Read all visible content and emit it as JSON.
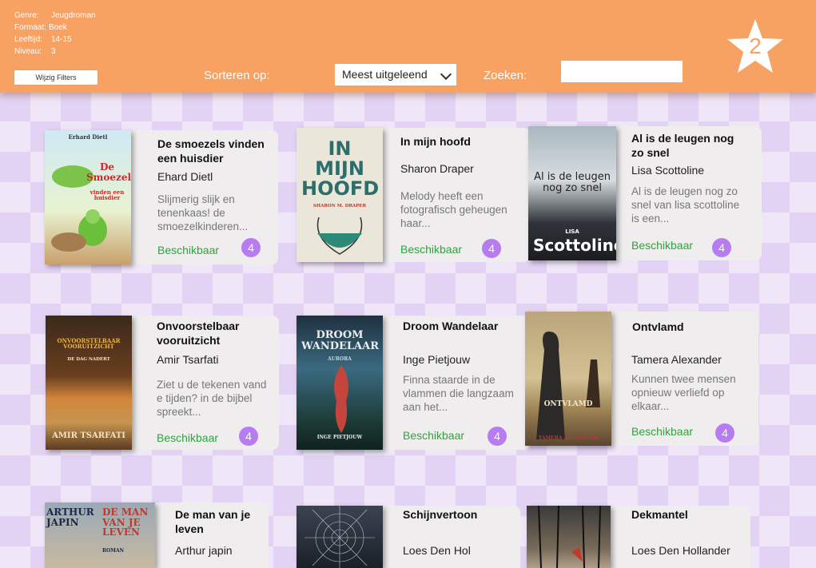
{
  "filters": {
    "genre_label": "Genre:",
    "genre": "Jeugdroman",
    "format_label": "Formaat:",
    "format": "Boek",
    "age_label": "Leeftijd:",
    "age": "14-15",
    "level_label": "Niveau:",
    "level": "3",
    "edit_button": "Wijzig Filters"
  },
  "sort": {
    "label": "Sorteren op:",
    "selected": "Meest uitgeleend"
  },
  "search": {
    "label": "Zoeken:",
    "placeholder": ""
  },
  "star_count": "2",
  "colors": {
    "accent": "#f7a163",
    "available": "#2ea43d",
    "badge": "#b77bf2"
  },
  "books": [
    {
      "title": "De smoezels vinden een huisdier",
      "author": "Ehard Dietl",
      "description": "Slijmerig slijk en tenenkaas! de smoezelkinderen...",
      "status": "Beschikbaar",
      "count": "4",
      "cover": {
        "top": "Erhard Dietl",
        "main": "De Smoezels",
        "sub": "vinden een huisdier"
      }
    },
    {
      "title": "In mijn hoofd",
      "author": "Sharon Draper",
      "description": "Melody heeft een fotografisch geheugen haar...",
      "status": "Beschikbaar",
      "count": "4",
      "cover": {
        "main": "IN MIJN HOOFD",
        "sub": "SHARON M. DRAPER"
      }
    },
    {
      "title": "Al is de leugen nog zo snel",
      "author": "Lisa Scottoline",
      "description": "Al is de leugen nog zo snel van lisa scottoline is een...",
      "status": "Beschikbaar",
      "count": "4",
      "cover": {
        "main": "Al is de leugen nog zo snel",
        "sub": "Scottoline",
        "top": "LISA"
      }
    },
    {
      "title": "Onvoorstelbaar vooruitzicht",
      "author": "Amir Tsarfati",
      "description": "Ziet u de tekenen vand e tijden? in de bijbel spreekt...",
      "status": "Beschikbaar",
      "count": "4",
      "cover": {
        "main": "ONVOORSTELBAAR VOORUITZICHT",
        "top": "DE DAG NADERT",
        "sub": "AMIR TSARFATI"
      }
    },
    {
      "title": "Droom Wandelaar",
      "author": "Inge Pietjouw",
      "description": "Finna staarde in de vlammen die langzaam aan het...",
      "status": "Beschikbaar",
      "count": "4",
      "cover": {
        "main": "DROOM WANDELAAR",
        "top": "AURORA",
        "sub": "INGE PIETJOUW"
      }
    },
    {
      "title": "Ontvlamd",
      "author": "Tamera Alexander",
      "description": "Kunnen twee mensen opnieuw verliefd op elkaar...",
      "status": "Beschikbaar",
      "count": "4",
      "cover": {
        "main": "ONTVLAMD",
        "sub": "TAMERA ALEXANDER"
      }
    },
    {
      "title": "De man van je leven",
      "author": "Arthur japin",
      "cover": {
        "main": "ARTHUR JAPIN",
        "sub": "DE MAN VAN JE LEVEN",
        "top": "ROMAN"
      }
    },
    {
      "title": "Schijnvertoon",
      "author": "Loes Den Hol",
      "cover": {}
    },
    {
      "title": "Dekmantel",
      "author": "Loes Den Hollander",
      "cover": {}
    }
  ]
}
